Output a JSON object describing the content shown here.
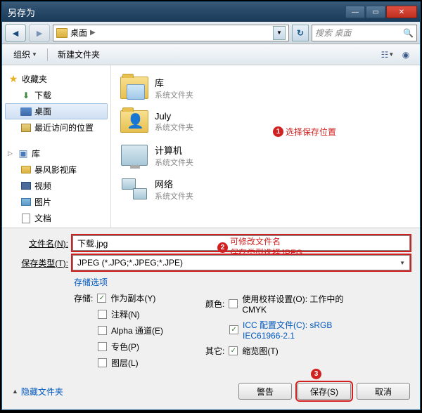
{
  "window": {
    "title": "另存为"
  },
  "nav": {
    "path_item": "桌面",
    "search_placeholder": "搜索 桌面"
  },
  "toolbar": {
    "organize": "组织",
    "new_folder": "新建文件夹"
  },
  "sidebar": {
    "favorites": {
      "label": "收藏夹"
    },
    "downloads": {
      "label": "下载"
    },
    "desktop": {
      "label": "桌面"
    },
    "recent": {
      "label": "最近访问的位置"
    },
    "libraries": {
      "label": "库"
    },
    "storm": {
      "label": "暴风影视库"
    },
    "videos": {
      "label": "视频"
    },
    "pictures": {
      "label": "图片"
    },
    "documents": {
      "label": "文档"
    }
  },
  "content": {
    "items": [
      {
        "name": "库",
        "sub": "系统文件夹"
      },
      {
        "name": "July",
        "sub": "系统文件夹"
      },
      {
        "name": "计算机",
        "sub": "系统文件夹"
      },
      {
        "name": "网络",
        "sub": "系统文件夹"
      }
    ]
  },
  "annotations": {
    "a1": "选择保存位置",
    "a2a": "可修改文件名",
    "a2b": "保存类型选择JPEG"
  },
  "form": {
    "filename_label": "文件名(N):",
    "filename_value": "下载.jpg",
    "filetype_label": "保存类型(T):",
    "filetype_value": "JPEG (*.JPG;*.JPEG;*.JPE)",
    "save_options": "存储选项",
    "storage_label": "存储:",
    "as_copy": "作为副本(Y)",
    "notes": "注释(N)",
    "alpha": "Alpha 通道(E)",
    "spot": "专色(P)",
    "layers": "图层(L)",
    "color_label": "颜色:",
    "proof": "使用校样设置(O): 工作中的 CMYK",
    "icc": "ICC 配置文件(C): sRGB IEC61966-2.1",
    "other_label": "其它:",
    "thumbnail": "缩览图(T)"
  },
  "footer": {
    "hide": "隐藏文件夹",
    "warn": "警告",
    "save": "保存(S)",
    "cancel": "取消"
  }
}
